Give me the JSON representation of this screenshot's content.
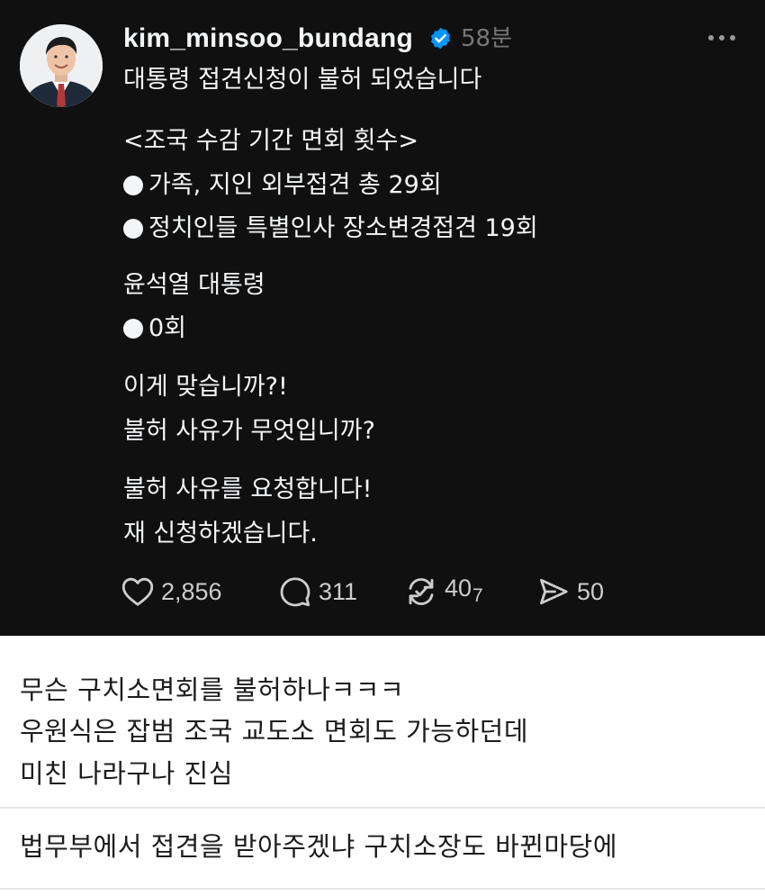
{
  "post": {
    "username": "kim_minsoo_bundang",
    "timestamp": "58분",
    "lines": [
      "대통령 접견신청이 불허 되었습니다",
      "<조국 수감 기간 면회 횟수>",
      "가족, 지인 외부접견 총 29회",
      "정치인들 특별인사 장소변경접견 19회",
      "윤석열 대통령",
      "0회",
      "이게 맞습니까?!",
      "불허 사유가 무엇입니까?",
      "불허 사유를 요청합니다!",
      "재 신청하겠습니다."
    ],
    "actions": {
      "likes": "2,856",
      "replies": "311",
      "reposts": "40",
      "reposts_suffix": "7",
      "shares": "50"
    },
    "icons": [
      "verified-badge-icon",
      "more-options-icon",
      "heart-icon",
      "comment-icon",
      "repost-icon",
      "share-icon"
    ],
    "colors": {
      "background": "#101010",
      "text": "#f3f5f7",
      "muted": "#777777",
      "verified": "#0095f6"
    }
  },
  "comments": [
    {
      "lines": [
        "무슨 구치소면회를 불허하나ㅋㅋㅋ",
        "우원식은 잡범 조국 교도소 면회도 가능하던데",
        "미친 나라구나 진심"
      ]
    },
    {
      "lines": [
        "법무부에서 접견을 받아주겠냐 구치소장도 바뀐마당에"
      ]
    }
  ]
}
